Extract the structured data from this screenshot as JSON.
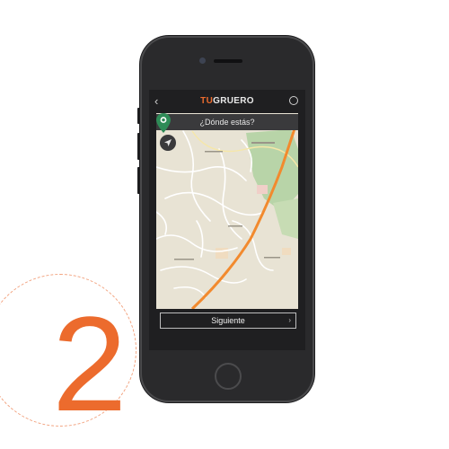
{
  "step": {
    "number": "2"
  },
  "app": {
    "brand_part1": "TU",
    "brand_part2": "GRUERO"
  },
  "map": {
    "search_placeholder": "¿Dónde estás?"
  },
  "footer": {
    "next_label": "Siguiente",
    "next_chevron": "›"
  },
  "icons": {
    "back": "‹"
  },
  "colors": {
    "accent": "#ec6b2d",
    "pin": "#2e8b57",
    "route": "#f28a2e"
  }
}
